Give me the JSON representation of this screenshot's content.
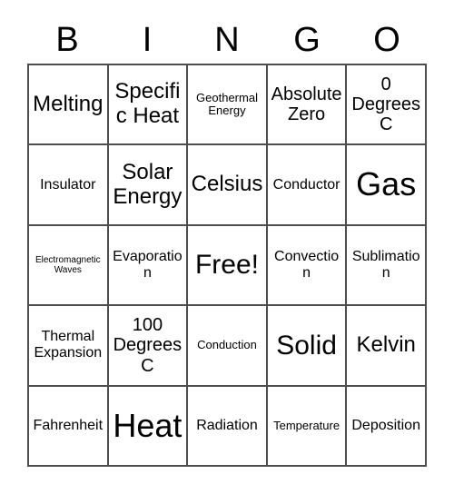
{
  "header": {
    "letters": [
      "B",
      "I",
      "N",
      "G",
      "O"
    ]
  },
  "grid": {
    "rows": [
      [
        {
          "text": "Melting",
          "size": "fs-xl"
        },
        {
          "text": "Specific Heat",
          "size": "fs-xl"
        },
        {
          "text": "Geothermal Energy",
          "size": "fs-sm"
        },
        {
          "text": "Absolute Zero",
          "size": "fs-lg"
        },
        {
          "text": "0 Degrees C",
          "size": "fs-lg"
        }
      ],
      [
        {
          "text": "Insulator",
          "size": "fs-md"
        },
        {
          "text": "Solar Energy",
          "size": "fs-xl"
        },
        {
          "text": "Celsius",
          "size": "fs-xl"
        },
        {
          "text": "Conductor",
          "size": "fs-md"
        },
        {
          "text": "Gas",
          "size": "fs-huge"
        }
      ],
      [
        {
          "text": "Electromagnetic Waves",
          "size": "fs-xs"
        },
        {
          "text": "Evaporation",
          "size": "fs-md"
        },
        {
          "text": "Free!",
          "size": "fs-xxl"
        },
        {
          "text": "Convection",
          "size": "fs-md"
        },
        {
          "text": "Sublimation",
          "size": "fs-md"
        }
      ],
      [
        {
          "text": "Thermal Expansion",
          "size": "fs-md"
        },
        {
          "text": "100 Degrees C",
          "size": "fs-lg"
        },
        {
          "text": "Conduction",
          "size": "fs-sm"
        },
        {
          "text": "Solid",
          "size": "fs-xxl"
        },
        {
          "text": "Kelvin",
          "size": "fs-xl"
        }
      ],
      [
        {
          "text": "Fahrenheit",
          "size": "fs-md"
        },
        {
          "text": "Heat",
          "size": "fs-huge"
        },
        {
          "text": "Radiation",
          "size": "fs-md"
        },
        {
          "text": "Temperature",
          "size": "fs-sm"
        },
        {
          "text": "Deposition",
          "size": "fs-md"
        }
      ]
    ]
  },
  "colors": {
    "border": "#4d4d4d",
    "text": "#000000",
    "background": "#ffffff"
  }
}
